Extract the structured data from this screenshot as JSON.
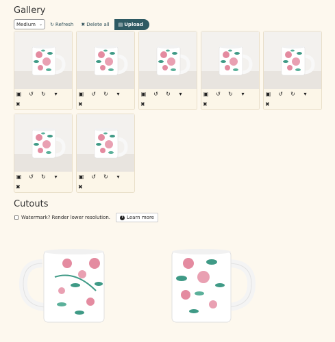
{
  "gallery": {
    "title": "Gallery"
  },
  "toolbar": {
    "size_select": "Medium",
    "refresh_label": "Refresh",
    "delete_all_label": "Delete all",
    "upload_label": "Upload"
  },
  "cards": [
    {
      "image": "mug-photo"
    },
    {
      "image": "mug-photo"
    },
    {
      "image": "mug-photo"
    },
    {
      "image": "mug-photo"
    },
    {
      "image": "mug-photo"
    },
    {
      "image": "mug-photo"
    },
    {
      "image": "mug-photo"
    }
  ],
  "card_icons": [
    "copy-icon",
    "rotate-left-icon",
    "rotate-right-icon",
    "caret-down-icon",
    "delete-icon"
  ],
  "cutouts": {
    "title": "Cutouts",
    "watermark_label": "Watermark? Render lower resolution.",
    "learn_more_label": "Learn more"
  },
  "colors": {
    "accent": "#2e5a63",
    "background": "#fdf8ee",
    "card_border": "#e9dfc9",
    "rose": "#e48ba0",
    "leaf": "#3f9a86"
  }
}
